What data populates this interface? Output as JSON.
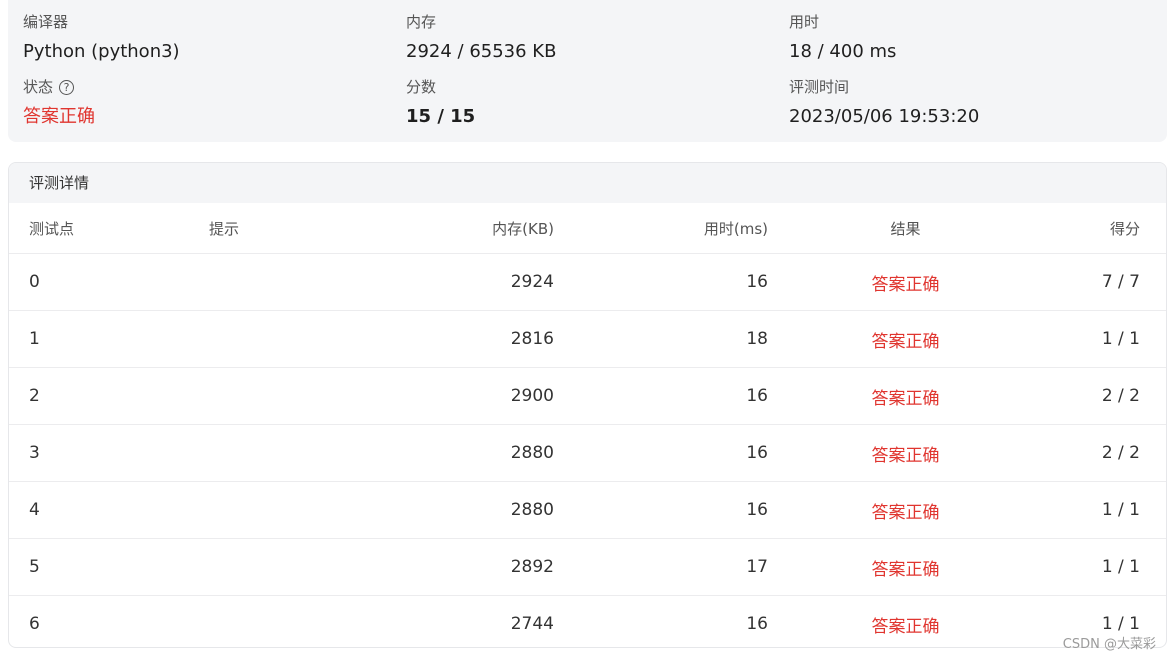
{
  "summary": {
    "compiler_label": "编译器",
    "compiler_value": "Python (python3)",
    "memory_label": "内存",
    "memory_value": "2924 / 65536 KB",
    "time_label": "用时",
    "time_value": "18 / 400 ms",
    "status_label": "状态",
    "status_help_icon": "question-circle-icon",
    "status_value": "答案正确",
    "score_label": "分数",
    "score_value": "15 / 15",
    "judge_time_label": "评测时间",
    "judge_time_value": "2023/05/06 19:53:20"
  },
  "details": {
    "title": "评测详情",
    "columns": [
      "测试点",
      "提示",
      "内存(KB)",
      "用时(ms)",
      "结果",
      "得分"
    ],
    "rows": [
      {
        "point": "0",
        "hint": "",
        "memory": "2924",
        "time": "16",
        "result": "答案正确",
        "score": "7 / 7"
      },
      {
        "point": "1",
        "hint": "",
        "memory": "2816",
        "time": "18",
        "result": "答案正确",
        "score": "1 / 1"
      },
      {
        "point": "2",
        "hint": "",
        "memory": "2900",
        "time": "16",
        "result": "答案正确",
        "score": "2 / 2"
      },
      {
        "point": "3",
        "hint": "",
        "memory": "2880",
        "time": "16",
        "result": "答案正确",
        "score": "2 / 2"
      },
      {
        "point": "4",
        "hint": "",
        "memory": "2880",
        "time": "16",
        "result": "答案正确",
        "score": "1 / 1"
      },
      {
        "point": "5",
        "hint": "",
        "memory": "2892",
        "time": "17",
        "result": "答案正确",
        "score": "1 / 1"
      },
      {
        "point": "6",
        "hint": "",
        "memory": "2744",
        "time": "16",
        "result": "答案正确",
        "score": "1 / 1"
      }
    ]
  },
  "colors": {
    "accepted": "#e0352f",
    "panel_bg": "#f4f5f7"
  },
  "watermark": "CSDN @大菜彩"
}
